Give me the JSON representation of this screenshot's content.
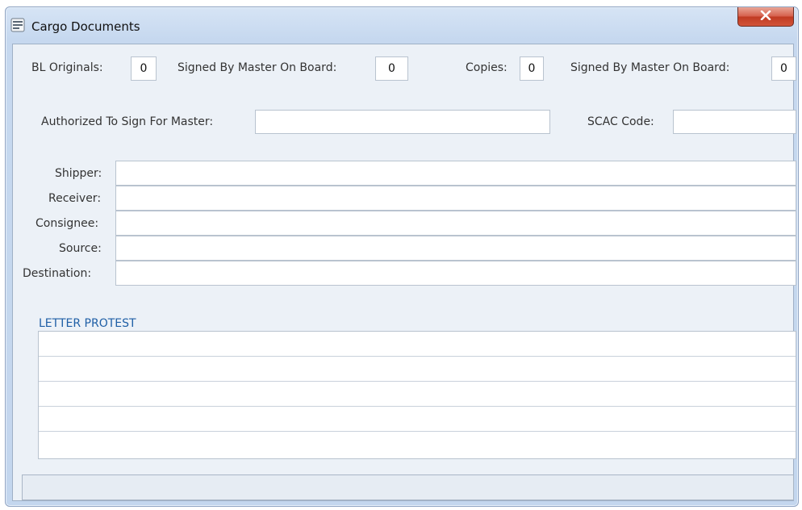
{
  "window": {
    "title": "Cargo Documents",
    "close_label": "x"
  },
  "copies_row": {
    "bl_originals_label": "BL Originals:",
    "bl_originals_value": "0",
    "signed_master_1_label": "Signed By Master On Board:",
    "signed_master_1_value": "0",
    "copies_label": "Copies:",
    "copies_value": "0",
    "signed_master_2_label": "Signed By Master On Board:",
    "signed_master_2_value": "0"
  },
  "authorized_label": "Authorized To Sign For Master:",
  "authorized_value": "",
  "scac_label": "SCAC Code:",
  "scac_value": "",
  "parties": {
    "shipper_label": "Shipper:",
    "receiver_label": "Receiver:",
    "consignee_label": "Consignee:",
    "source_label": "Source:",
    "destination_label": "Destination:"
  },
  "letter_protest": {
    "title": "LETTER PROTEST",
    "rows": [
      "",
      "",
      "",
      "",
      ""
    ]
  },
  "colors": {
    "accent": "#1f5fa6",
    "close": "#c8452c"
  }
}
